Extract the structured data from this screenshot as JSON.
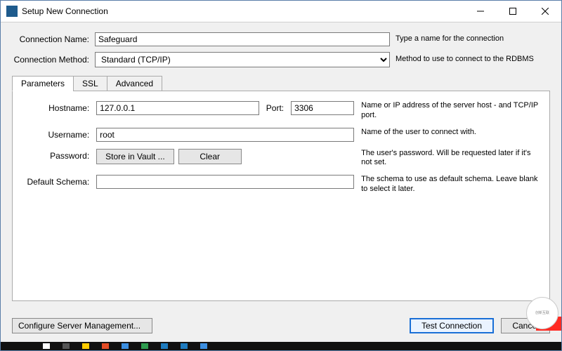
{
  "window": {
    "title": "Setup New Connection"
  },
  "header": {
    "connectionNameLabel": "Connection Name:",
    "connectionName": "Safeguard",
    "connectionNameHint": "Type a name for the connection",
    "connectionMethodLabel": "Connection Method:",
    "connectionMethod": "Standard (TCP/IP)",
    "connectionMethodHint": "Method to use to connect to the RDBMS"
  },
  "tabs": {
    "parameters": "Parameters",
    "ssl": "SSL",
    "advanced": "Advanced"
  },
  "params": {
    "hostnameLabel": "Hostname:",
    "hostname": "127.0.0.1",
    "portLabel": "Port:",
    "port": "3306",
    "hostHint": "Name or IP address of the server host - and TCP/IP port.",
    "usernameLabel": "Username:",
    "username": "root",
    "userHint": "Name of the user to connect with.",
    "passwordLabel": "Password:",
    "storeVault": "Store in Vault ...",
    "clear": "Clear",
    "passHint": "The user's password. Will be requested later if it's not set.",
    "schemaLabel": "Default Schema:",
    "schema": "",
    "schemaHint": "The schema to use as default schema. Leave blank to select it later."
  },
  "footer": {
    "configure": "Configure Server Management...",
    "test": "Test Connection",
    "cancel": "Cancel"
  }
}
